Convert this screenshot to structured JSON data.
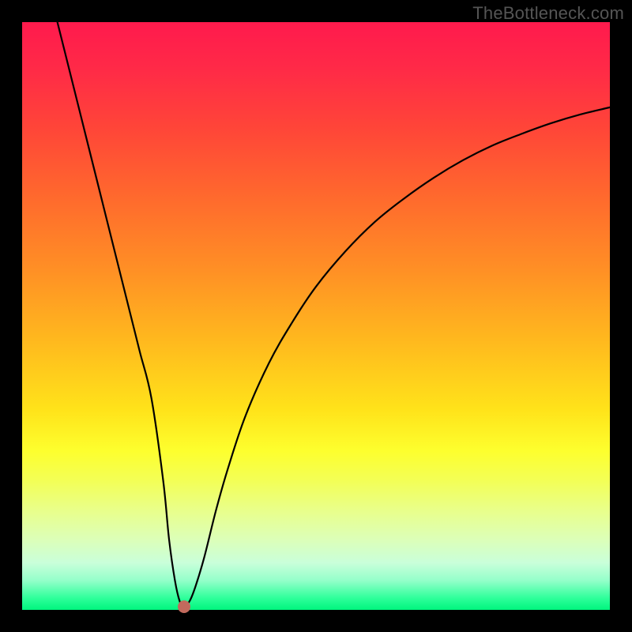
{
  "watermark": "TheBottleneck.com",
  "chart_data": {
    "type": "line",
    "title": "",
    "xlabel": "",
    "ylabel": "",
    "xlim": [
      0,
      100
    ],
    "ylim": [
      0,
      100
    ],
    "series": [
      {
        "name": "curve",
        "x": [
          6,
          8,
          10,
          12,
          14,
          16,
          18,
          20,
          22,
          24,
          25,
          26,
          26.8,
          27.5,
          28.5,
          29.5,
          31,
          33,
          35,
          38,
          42,
          46,
          50,
          55,
          60,
          65,
          70,
          75,
          80,
          85,
          90,
          95,
          100
        ],
        "y": [
          100,
          92,
          84,
          76,
          68,
          60,
          52,
          44,
          36,
          22,
          12,
          5,
          1.5,
          0.5,
          1.5,
          4,
          9,
          17,
          24,
          33,
          42,
          49,
          55,
          61,
          66,
          70,
          73.5,
          76.5,
          79,
          81,
          82.8,
          84.3,
          85.5
        ]
      }
    ],
    "marker": {
      "x": 27.5,
      "y": 0.6
    },
    "background": {
      "type": "vertical-gradient",
      "stops": [
        {
          "pos": 0,
          "color": "#ff1a4d"
        },
        {
          "pos": 50,
          "color": "#ffb81e"
        },
        {
          "pos": 75,
          "color": "#fdff2e"
        },
        {
          "pos": 100,
          "color": "#00f57e"
        }
      ]
    }
  }
}
